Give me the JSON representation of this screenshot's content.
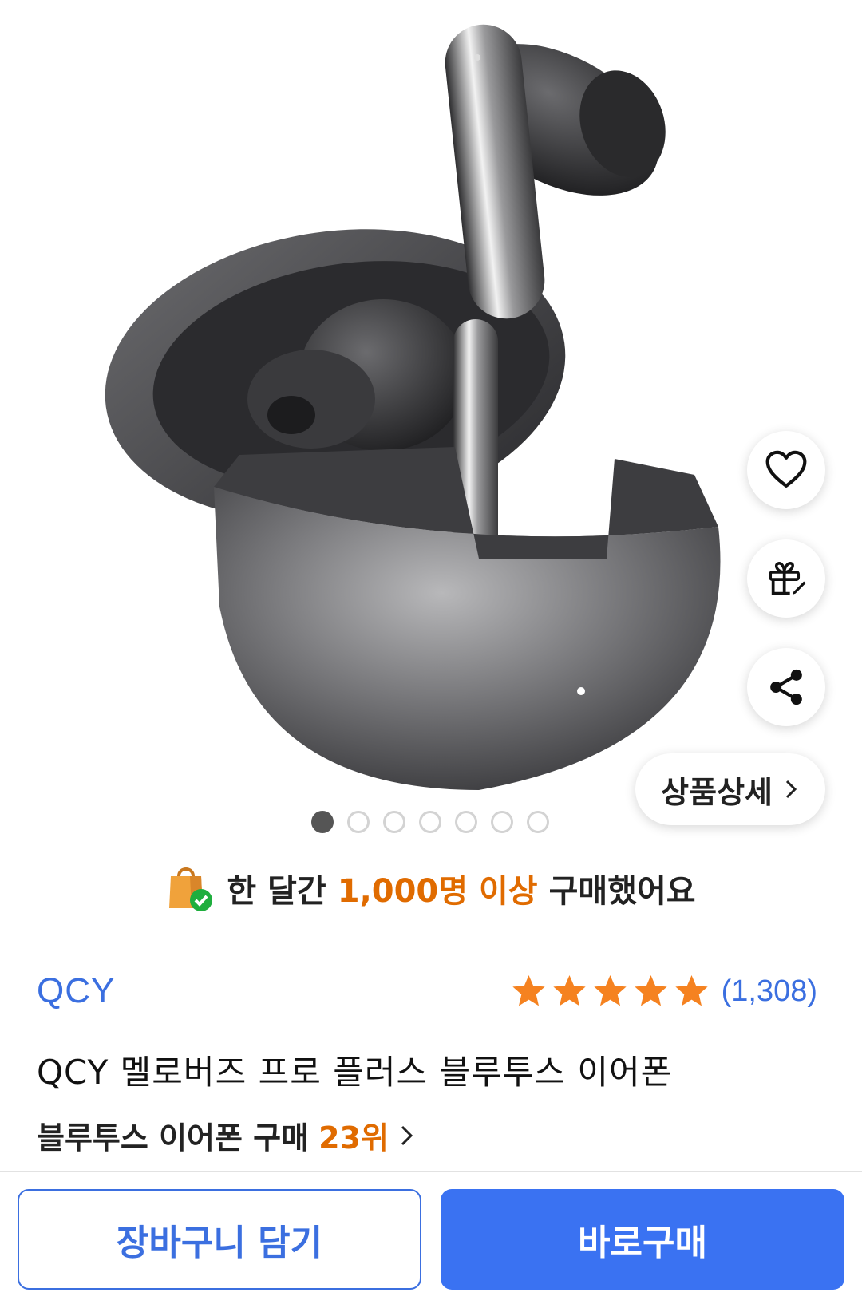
{
  "actions": {
    "detail_label": "상품상세"
  },
  "carousel": {
    "total": 7,
    "current": 1
  },
  "purchase_badge": {
    "prefix": "한 달간",
    "highlight": "1,000명 이상",
    "suffix": "구매했어요"
  },
  "product": {
    "brand": "QCY",
    "rating_stars": 5,
    "review_count": "(1,308)",
    "title": "QCY 멜로버즈 프로 플러스 블루투스 이어폰"
  },
  "ranking": {
    "category": "블루투스 이어폰 구매",
    "rank": "23위"
  },
  "buttons": {
    "cart_label": "장바구니 담기",
    "buy_label": "바로구매"
  },
  "colors": {
    "accent": "#3a72f2",
    "brand_text": "#3b6fe0",
    "highlight": "#e06b00",
    "star": "#f58220"
  }
}
